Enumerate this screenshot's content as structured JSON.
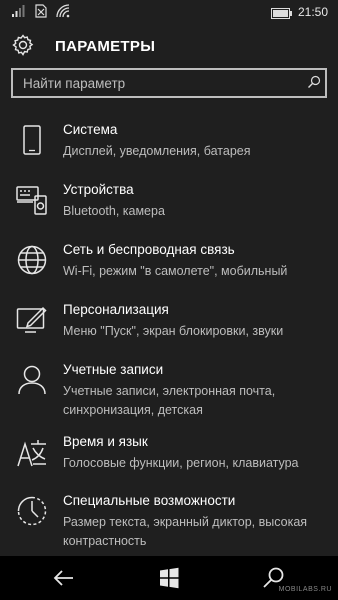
{
  "status": {
    "time": "21:50"
  },
  "header": {
    "title": "ПАРАМЕТРЫ"
  },
  "search": {
    "placeholder": "Найти параметр"
  },
  "items": [
    {
      "title": "Система",
      "subtitle": "Дисплей, уведомления, батарея",
      "icon": "phone-icon"
    },
    {
      "title": "Устройства",
      "subtitle": "Bluetooth, камера",
      "icon": "devices-icon"
    },
    {
      "title": "Сеть и беспроводная связь",
      "subtitle": "Wi-Fi, режим \"в самолете\", мобильный",
      "icon": "globe-icon"
    },
    {
      "title": "Персонализация",
      "subtitle": "Меню \"Пуск\", экран блокировки, звуки",
      "icon": "personalization-icon"
    },
    {
      "title": "Учетные записи",
      "subtitle": "Учетные записи, электронная почта, синхронизация, детская",
      "icon": "person-icon"
    },
    {
      "title": "Время и язык",
      "subtitle": "Голосовые функции, регион, клавиатура",
      "icon": "time-language-icon"
    },
    {
      "title": "Специальные возможности",
      "subtitle": "Размер текста, экранный диктор, высокая контрастность",
      "icon": "accessibility-icon"
    }
  ],
  "watermark": "MOBILABS.RU"
}
